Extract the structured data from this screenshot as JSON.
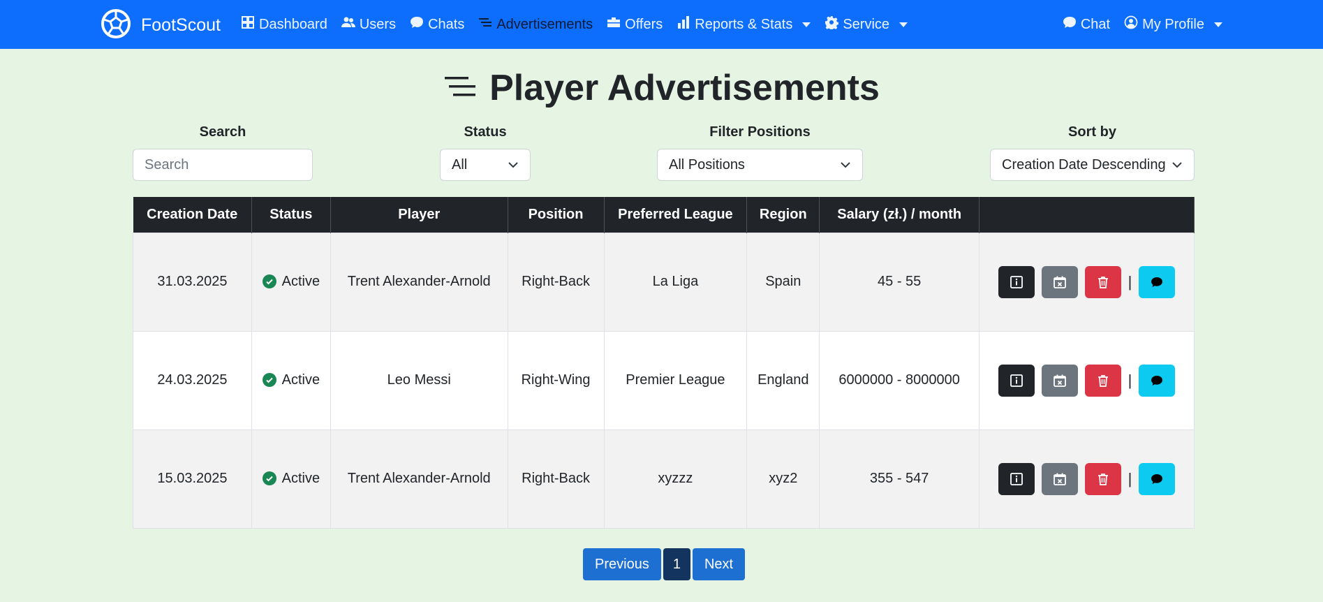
{
  "brand": {
    "name": "FootScout"
  },
  "nav": {
    "left": [
      {
        "label": "Dashboard",
        "icon": "grid-icon"
      },
      {
        "label": "Users",
        "icon": "users-icon"
      },
      {
        "label": "Chats",
        "icon": "chat-icon"
      },
      {
        "label": "Advertisements",
        "icon": "list-icon",
        "active": true
      },
      {
        "label": "Offers",
        "icon": "briefcase-icon"
      },
      {
        "label": "Reports & Stats",
        "icon": "bar-chart-icon",
        "dropdown": true
      },
      {
        "label": "Service",
        "icon": "gear-icon",
        "dropdown": true
      }
    ],
    "right": [
      {
        "label": "Chat",
        "icon": "chat-icon"
      },
      {
        "label": "My Profile",
        "icon": "user-circle-icon",
        "dropdown": true
      }
    ]
  },
  "page": {
    "title": "Player Advertisements"
  },
  "filters": {
    "search": {
      "label": "Search",
      "placeholder": "Search",
      "value": ""
    },
    "status": {
      "label": "Status",
      "value": "All"
    },
    "positions": {
      "label": "Filter Positions",
      "value": "All Positions"
    },
    "sort": {
      "label": "Sort by",
      "value": "Creation Date Descending"
    }
  },
  "table": {
    "headers": [
      "Creation Date",
      "Status",
      "Player",
      "Position",
      "Preferred League",
      "Region",
      "Salary (zł.) / month",
      ""
    ],
    "rows": [
      {
        "date": "31.03.2025",
        "status": "Active",
        "player": "Trent Alexander-Arnold",
        "position": "Right-Back",
        "league": "La Liga",
        "region": "Spain",
        "salary": "45 - 55"
      },
      {
        "date": "24.03.2025",
        "status": "Active",
        "player": "Leo Messi",
        "position": "Right-Wing",
        "league": "Premier League",
        "region": "England",
        "salary": "6000000 - 8000000"
      },
      {
        "date": "15.03.2025",
        "status": "Active",
        "player": "Trent Alexander-Arnold",
        "position": "Right-Back",
        "league": "xyzzz",
        "region": "xyz2",
        "salary": "355 - 547"
      }
    ],
    "action_separator": "|"
  },
  "pagination": {
    "previous": "Previous",
    "current": "1",
    "next": "Next"
  },
  "colors": {
    "navbar": "#0d6efd",
    "background": "#e6f5e3",
    "active_status": "#198754"
  }
}
